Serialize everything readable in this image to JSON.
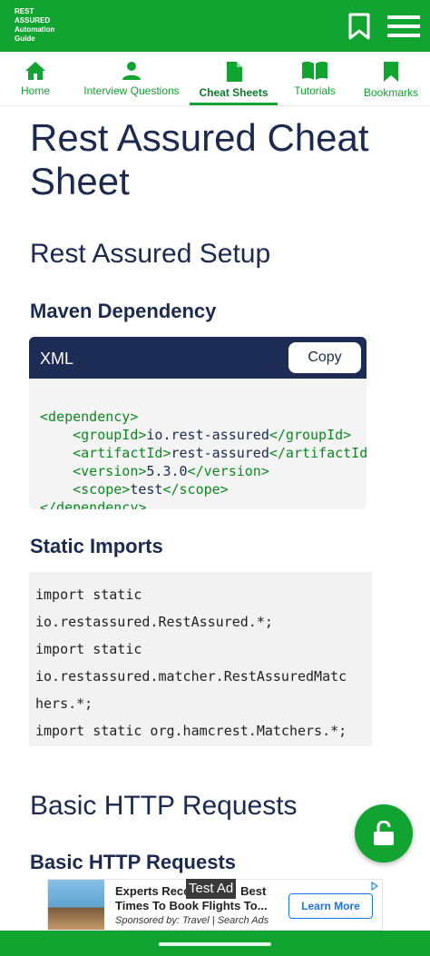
{
  "app": {
    "logo_lines": [
      "REST",
      "ASSURED",
      "Automation",
      "Guide"
    ],
    "bar_color": "#11a431",
    "icons": [
      "bookmark-icon",
      "menu-icon"
    ]
  },
  "nav": {
    "tabs": [
      {
        "label": "Home",
        "icon": "home-icon"
      },
      {
        "label": "Interview Questions",
        "icon": "person-icon"
      },
      {
        "label": "Cheat Sheets",
        "icon": "document-icon",
        "active": true
      },
      {
        "label": "Tutorials",
        "icon": "book-icon"
      },
      {
        "label": "Bookmarks",
        "icon": "bookmark-icon"
      }
    ]
  },
  "content": {
    "page_title": "Rest Assured Cheat Sheet",
    "setup_heading": "Rest Assured Setup",
    "maven_heading": "Maven Dependency",
    "maven_code": {
      "language": "XML",
      "copy_label": "Copy",
      "lines": [
        {
          "indent": "",
          "open": "<dependency>",
          "text": "",
          "close": ""
        },
        {
          "indent": "    ",
          "open": "<groupId>",
          "text": "io.rest-assured",
          "close": "</groupId>"
        },
        {
          "indent": "    ",
          "open": "<artifactId>",
          "text": "rest-assured",
          "close": "</artifactId>"
        },
        {
          "indent": "    ",
          "open": "<version>",
          "text": "5.3.0",
          "close": "</version>"
        },
        {
          "indent": "    ",
          "open": "<scope>",
          "text": "test",
          "close": "</scope>"
        },
        {
          "indent": "",
          "open": "</dependency>",
          "text": "",
          "close": ""
        }
      ]
    },
    "imports_heading": "Static Imports",
    "imports_lines": [
      "import static",
      "io.restassured.RestAssured.*;",
      "import static",
      "io.restassured.matcher.RestAssuredMatc",
      "hers.*;",
      "import static org.hamcrest.Matchers.*;"
    ],
    "http_heading": "Basic HTTP Requests",
    "http_subheading": "Basic HTTP Requests"
  },
  "fab": {
    "icon": "unlock-icon"
  },
  "ad": {
    "title_line1": "Experts Reco",
    "title_line1_end": "Best",
    "title_line2": "Times To Book Flights To...",
    "sponsor": "Sponsored by: Travel | Search Ads",
    "button_label": "Learn More",
    "test_label": "Test Ad"
  }
}
